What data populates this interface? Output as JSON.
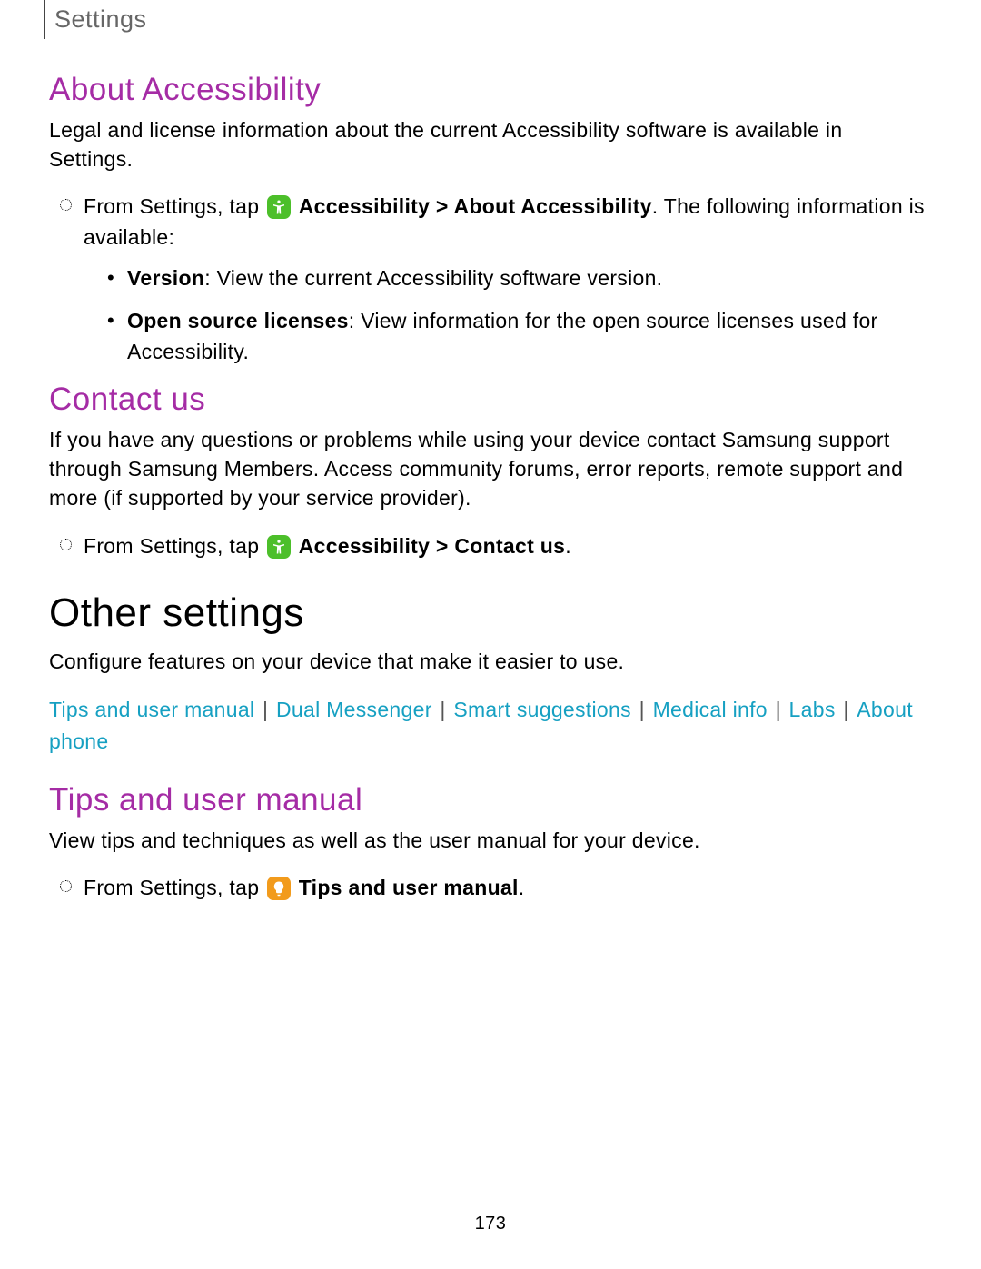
{
  "header": {
    "breadcrumb": "Settings"
  },
  "sections": {
    "about_accessibility": {
      "title": "About Accessibility",
      "intro": "Legal and license information about the current Accessibility software is available in Settings.",
      "step_prefix": "From Settings, tap ",
      "step_bold": "Accessibility > About Accessibility",
      "step_suffix": ". The following information is available:",
      "sub": [
        {
          "label": "Version",
          "text": ": View the current Accessibility software version."
        },
        {
          "label": "Open source licenses",
          "text": ": View information for the open source licenses used for Accessibility."
        }
      ]
    },
    "contact_us": {
      "title": "Contact us",
      "intro": "If you have any questions or problems while using your device contact Samsung support through Samsung Members. Access community forums, error reports, remote support and more (if supported by your service provider).",
      "step_prefix": "From Settings, tap ",
      "step_bold": "Accessibility > Contact us",
      "step_suffix": "."
    },
    "other_settings": {
      "title": "Other settings",
      "intro": "Configure features on your device that make it easier to use.",
      "links": [
        "Tips and user manual",
        "Dual Messenger",
        "Smart suggestions",
        "Medical info",
        "Labs",
        "About phone"
      ]
    },
    "tips": {
      "title": "Tips and user manual",
      "intro": "View tips and techniques as well as the user manual for your device.",
      "step_prefix": "From Settings, tap ",
      "step_bold": "Tips and user manual",
      "step_suffix": "."
    }
  },
  "page_number": "173"
}
